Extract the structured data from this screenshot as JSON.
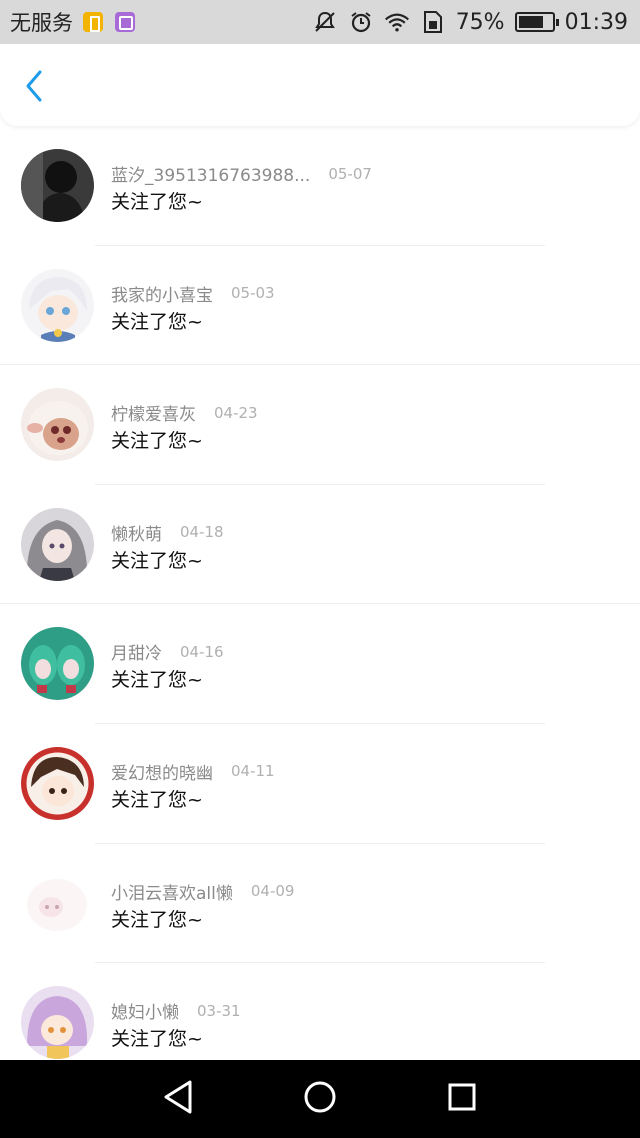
{
  "status_bar": {
    "carrier": "无服务",
    "battery_percent": "75%",
    "battery_level": 0.75,
    "time": "01:39",
    "icons": [
      "notification-app-icon",
      "notification-gallery-icon",
      "mute-icon",
      "alarm-icon",
      "wifi-icon",
      "sim-icon",
      "battery-icon"
    ]
  },
  "header": {
    "back_icon": "chevron-left-icon",
    "accent_color": "#1e9be9"
  },
  "followers": [
    {
      "nickname": "蓝汐_3951316763988...",
      "date": "05-07",
      "action": "关注了您~"
    },
    {
      "nickname": "我家的小喜宝",
      "date": "05-03",
      "action": "关注了您~"
    },
    {
      "nickname": "柠檬爱喜灰",
      "date": "04-23",
      "action": "关注了您~"
    },
    {
      "nickname": "懒秋萌",
      "date": "04-18",
      "action": "关注了您~"
    },
    {
      "nickname": "月甜冷",
      "date": "04-16",
      "action": "关注了您~"
    },
    {
      "nickname": "爱幻想的晓幽",
      "date": "04-11",
      "action": "关注了您~"
    },
    {
      "nickname": "小泪云喜欢all懒",
      "date": "04-09",
      "action": "关注了您~"
    },
    {
      "nickname": "媳妇小懒",
      "date": "03-31",
      "action": "关注了您~"
    }
  ],
  "nav_bar": {
    "icons": [
      "back-triangle-icon",
      "home-circle-icon",
      "recents-square-icon"
    ]
  }
}
